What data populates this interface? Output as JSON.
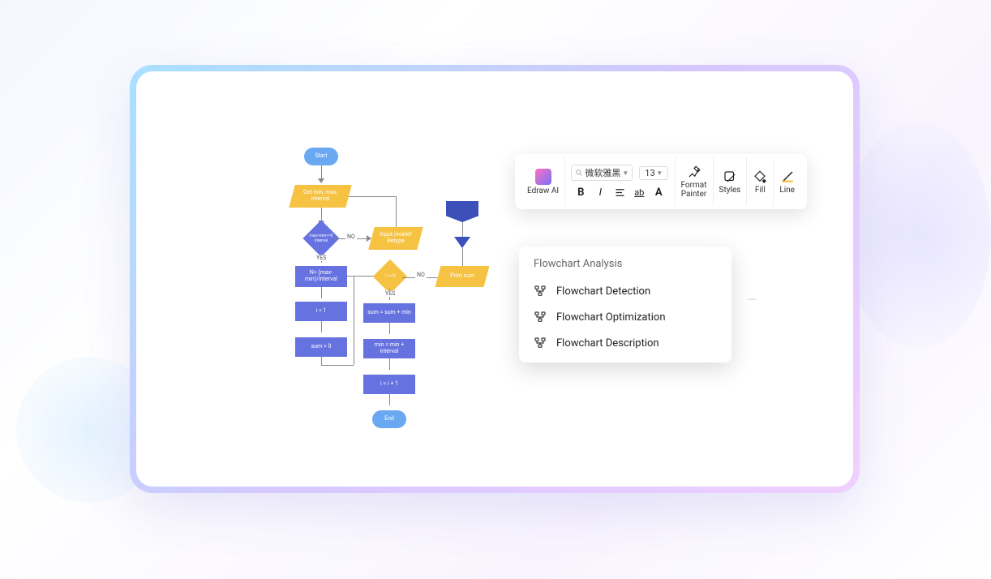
{
  "toolbar": {
    "edraw_ai_label": "Edraw AI",
    "font_name": "微软雅黑",
    "font_size": "13",
    "format_painter_label": "Format\nPainter",
    "styles_label": "Styles",
    "fill_label": "Fill",
    "line_label": "Line"
  },
  "ai_panel": {
    "title": "Flowchart Analysis",
    "items": [
      "Flowchart Detection",
      "Flowchart Optimization",
      "Flowchart Description"
    ]
  },
  "flowchart": {
    "nodes": {
      "start": "Start",
      "get_input": "Get min, max, interval",
      "validate": "max>min>=0 interval",
      "invalid_input": "Input invalid! Retype",
      "compute_n": "N= (max-min)/interval",
      "i_eq_1": "i = 1",
      "sum_eq_0": "sum = 0",
      "i_le_N": "i <= N",
      "sum_add": "sum = sum + min",
      "min_add": "min = min + interval",
      "i_inc": "i = i + 1",
      "print_sum": "Print sum",
      "end": "End"
    },
    "edges": {
      "no1": "NO",
      "yes1": "YES",
      "no2": "NO",
      "yes2": "YES"
    }
  },
  "colors": {
    "terminator": "#6aa9f2",
    "process": "#6572e0",
    "io": "#f5c242",
    "flag": "#3d4fb8"
  }
}
